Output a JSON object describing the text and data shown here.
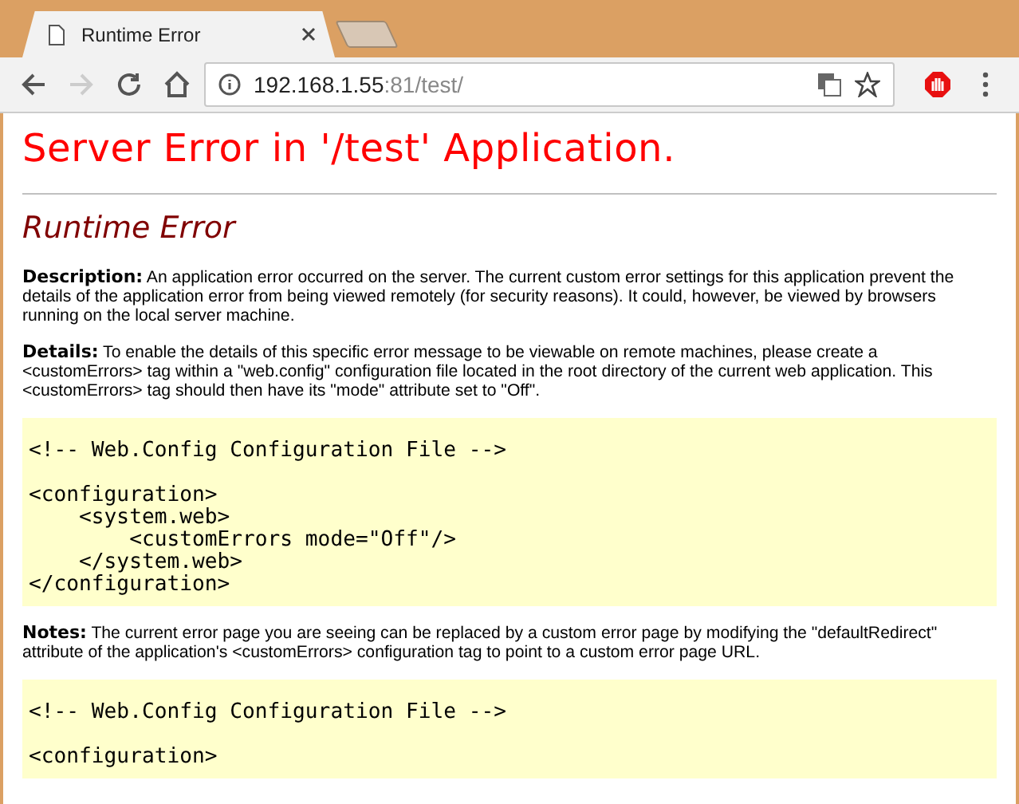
{
  "tabs": [
    {
      "title": "Runtime Error",
      "selected": true,
      "kind": "page"
    }
  ],
  "address_bar": {
    "host": "192.168.1.55",
    "rest": ":81/test/"
  },
  "page": {
    "heading": "Server Error in '/test' Application.",
    "subheading": "Runtime Error",
    "sections": [
      {
        "kind": "text",
        "text": "**Description:** An application error occurred on the server. The current custom error settings for this application prevent the details of the application error from being viewed remotely (for security reasons). It could, however, be viewed by browsers running on the local server machine."
      },
      {
        "kind": "text",
        "text": "**Details:** To enable the details of this specific error message to be viewable on remote machines, please create a <customErrors> tag within a \"web.config\" configuration file located in the root directory of the current web application. This <customErrors> tag should then have its \"mode\" attribute set to \"Off\"."
      },
      {
        "kind": "code",
        "groups": [
          [
            "<!-- Web.Config Configuration File -->"
          ],
          [
            "<configuration>",
            "    <system.web>",
            "        <customErrors mode=\"Off\"/>",
            "    </system.web>",
            "</configuration>"
          ]
        ]
      },
      {
        "kind": "text",
        "text": "**Notes:** The current error page you are seeing can be replaced by a custom error page by modifying the \"defaultRedirect\" attribute of the application's <customErrors> configuration tag to point to a custom error page URL."
      },
      {
        "kind": "code",
        "groups": [
          [
            "<!-- Web.Config Configuration File -->"
          ],
          [
            "<configuration>"
          ]
        ]
      }
    ]
  }
}
